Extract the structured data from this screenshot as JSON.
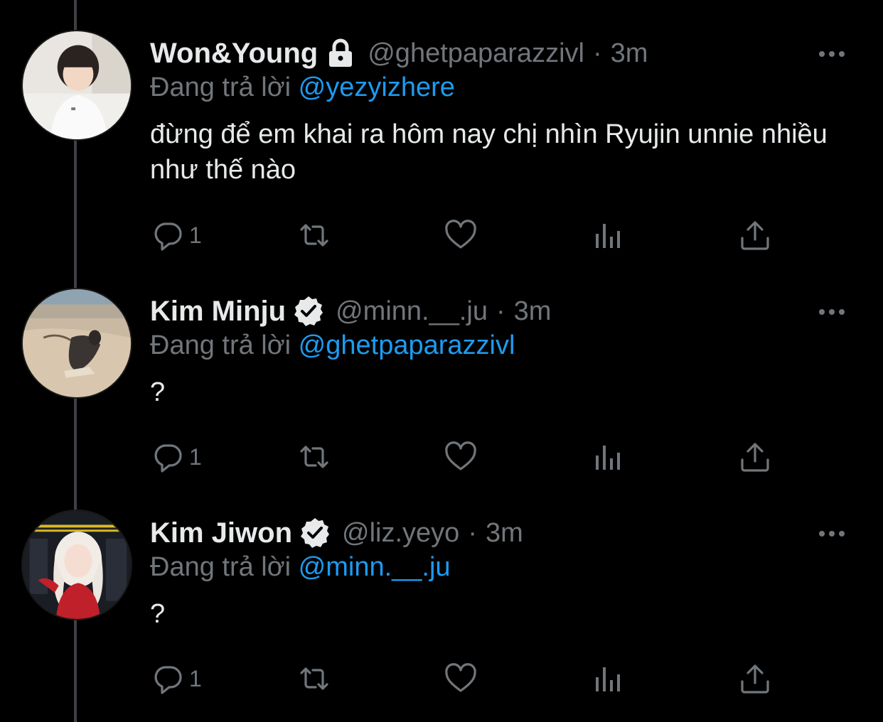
{
  "tweets": [
    {
      "name": "Won&Young",
      "badge": "lock-icon",
      "handle": "@ghetpaparazzivl",
      "separator": "·",
      "time": "3m",
      "reply_prefix": "Đang trả lời",
      "reply_to": "@yezyizhere",
      "text": "đừng để em khai ra hôm nay chị nhìn  Ryujin unnie nhiều như thế nào",
      "reply_count": "1"
    },
    {
      "name": "Kim Minju",
      "badge": "verified-icon",
      "handle": "@minn.__.ju",
      "separator": "·",
      "time": "3m",
      "reply_prefix": "Đang trả lời",
      "reply_to": "@ghetpaparazzivl",
      "text": "?",
      "reply_count": "1"
    },
    {
      "name": "Kim Jiwon",
      "badge": "verified-icon",
      "handle": "@liz.yeyo",
      "separator": "·",
      "time": "3m",
      "reply_prefix": "Đang trả lời",
      "reply_to": "@minn.__.ju",
      "text": "?",
      "reply_count": "1"
    }
  ],
  "icons": {
    "reply": "reply-icon",
    "retweet": "retweet-icon",
    "like": "heart-icon",
    "views": "analytics-icon",
    "share": "share-icon",
    "more": "more-icon"
  },
  "colors": {
    "background": "#000000",
    "text_primary": "#e7e9ea",
    "text_secondary": "#71767b",
    "link": "#1d9bf0",
    "thread_line": "#3e4144"
  }
}
